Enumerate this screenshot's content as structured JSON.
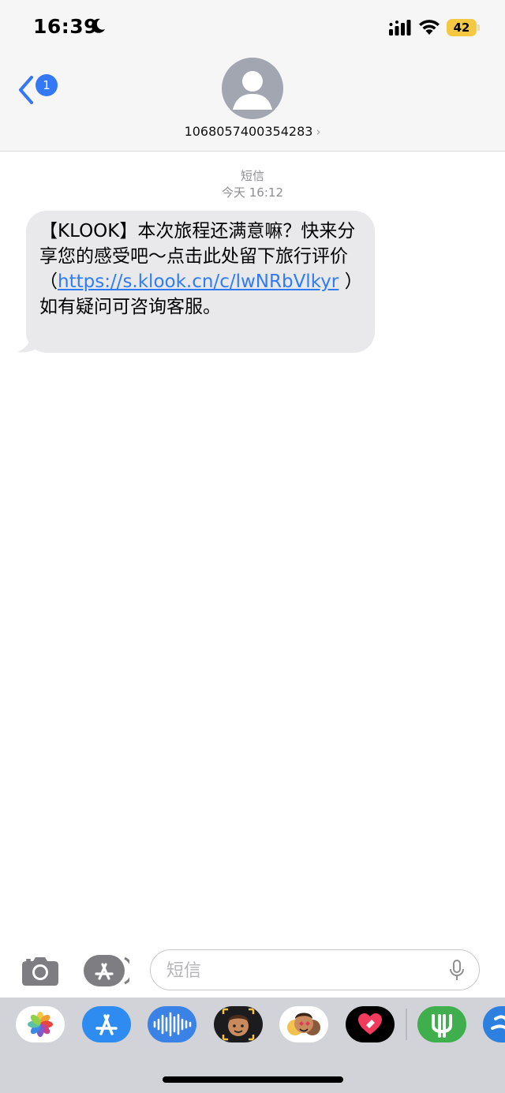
{
  "status_bar": {
    "time": "16:39",
    "battery": "42",
    "icons": [
      "moon-icon",
      "cellular-signal-icon",
      "wifi-icon",
      "battery-icon"
    ],
    "battery_color": "#f5c842"
  },
  "header": {
    "back_badge": "1",
    "contact_number": "1068057400354283",
    "chevron": "›",
    "accent": "#3478f6"
  },
  "conversation": {
    "service_label": "短信",
    "timestamp": "今天 16:12",
    "message": {
      "prefix": "【KLOOK】本次旅程还满意嘛？快来分享您的感受吧～点击此处留下旅行评价（",
      "link": "https://s.klook.cn/c/lwNRbVlkyr",
      "suffix": " ）如有疑问可咨询客服。"
    },
    "bubble_color": "#e9e9eb",
    "link_color": "#2f7cf6"
  },
  "input_bar": {
    "placeholder": "短信",
    "icons": [
      "camera-icon",
      "app-store-icon",
      "microphone-icon"
    ]
  },
  "app_drawer": {
    "apps": [
      "photos-app-icon",
      "app-store-app-icon",
      "audio-message-app-icon",
      "memoji-app-icon",
      "memoji-stickers-app-icon",
      "digital-touch-app-icon",
      "green-app-icon",
      "blue-app-icon"
    ]
  }
}
